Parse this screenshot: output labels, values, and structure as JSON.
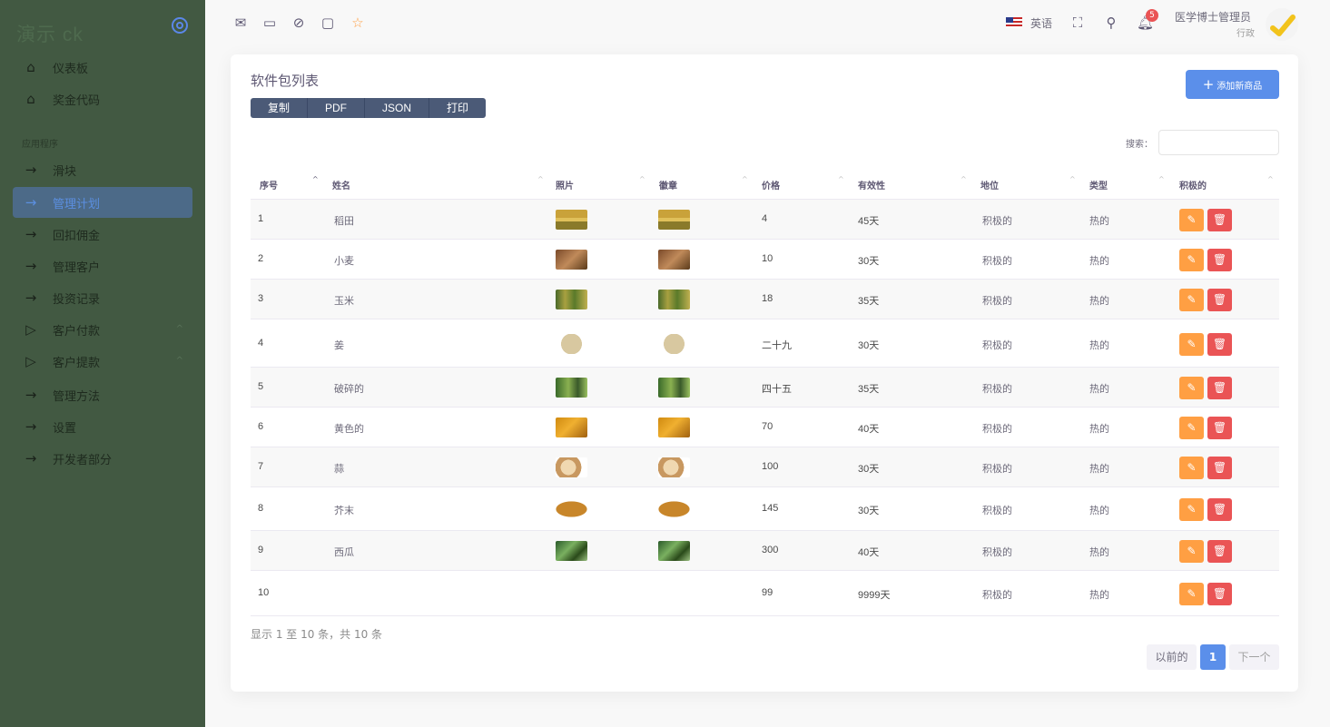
{
  "brand": {
    "name": "演示 ck"
  },
  "sidebar": {
    "section_label": "应用程序",
    "items": [
      {
        "label": "仪表板",
        "icon": "home-icon"
      },
      {
        "label": "奖金代码",
        "icon": "home-icon"
      },
      {
        "label": "滑块",
        "icon": "arrow-right-icon"
      },
      {
        "label": "管理计划",
        "icon": "arrow-right-icon",
        "active": true
      },
      {
        "label": "回扣佣金",
        "icon": "arrow-right-icon"
      },
      {
        "label": "管理客户",
        "icon": "arrow-right-icon"
      },
      {
        "label": "投资记录",
        "icon": "arrow-right-icon"
      },
      {
        "label": "客户付款",
        "icon": "play-icon",
        "expandable": true
      },
      {
        "label": "客户提款",
        "icon": "play-icon",
        "expandable": true
      },
      {
        "label": "管理方法",
        "icon": "arrow-right-icon"
      },
      {
        "label": "设置",
        "icon": "arrow-right-icon"
      },
      {
        "label": "开发者部分",
        "icon": "arrow-right-icon"
      }
    ]
  },
  "topbar": {
    "language": "英语",
    "notification_count": "5",
    "user_name": "医学博士管理员",
    "user_role": "行政"
  },
  "card": {
    "title": "软件包列表",
    "export_buttons": [
      "复制",
      "PDF",
      "JSON",
      "打印"
    ],
    "add_button": "添加新商品",
    "search_label": "搜索：",
    "search_value": ""
  },
  "table": {
    "headers": [
      "序号",
      "姓名",
      "照片",
      "徽章",
      "价格",
      "有效性",
      "地位",
      "类型",
      "积极的"
    ],
    "rows": [
      {
        "id": "1",
        "name": "稻田",
        "price": "4",
        "validity": "45天",
        "status": "积极的",
        "type": "热的",
        "img": "rice"
      },
      {
        "id": "2",
        "name": "小麦",
        "price": "10",
        "validity": "30天",
        "status": "积极的",
        "type": "热的",
        "img": "wheat"
      },
      {
        "id": "3",
        "name": "玉米",
        "price": "18",
        "validity": "35天",
        "status": "积极的",
        "type": "热的",
        "img": "corn"
      },
      {
        "id": "4",
        "name": "姜",
        "price": "二十九",
        "validity": "30天",
        "status": "积极的",
        "type": "热的",
        "img": "ginger"
      },
      {
        "id": "5",
        "name": "破碎的",
        "price": "四十五",
        "validity": "35天",
        "status": "积极的",
        "type": "热的",
        "img": "peas"
      },
      {
        "id": "6",
        "name": "黄色的",
        "price": "70",
        "validity": "40天",
        "status": "积极的",
        "type": "热的",
        "img": "turmeric"
      },
      {
        "id": "7",
        "name": "蒜",
        "price": "100",
        "validity": "30天",
        "status": "积极的",
        "type": "热的",
        "img": "garlic"
      },
      {
        "id": "8",
        "name": "芥末",
        "price": "145",
        "validity": "30天",
        "status": "积极的",
        "type": "热的",
        "img": "mustard"
      },
      {
        "id": "9",
        "name": "西瓜",
        "price": "300",
        "validity": "40天",
        "status": "积极的",
        "type": "热的",
        "img": "watermelon"
      },
      {
        "id": "10",
        "name": "",
        "price": "99",
        "validity": "9999天",
        "status": "积极的",
        "type": "热的",
        "img": ""
      }
    ]
  },
  "footer": {
    "info": "显示 1 至 10 条，共 10 条",
    "prev": "以前的",
    "page": "1",
    "next": "下一个"
  }
}
